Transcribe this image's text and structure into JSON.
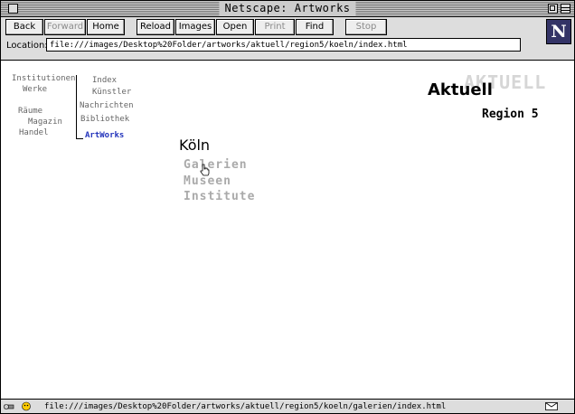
{
  "window": {
    "title": "Netscape: Artworks"
  },
  "toolbar": {
    "buttons": [
      {
        "label": "Back",
        "enabled": true
      },
      {
        "label": "Forward",
        "enabled": false
      },
      {
        "label": "Home",
        "enabled": true
      },
      {
        "label": "Reload",
        "enabled": true
      },
      {
        "label": "Images",
        "enabled": true
      },
      {
        "label": "Open",
        "enabled": true
      },
      {
        "label": "Print",
        "enabled": false
      },
      {
        "label": "Find",
        "enabled": true
      },
      {
        "label": "Stop",
        "enabled": false
      }
    ],
    "location_label": "Location:",
    "location_value": "file:///images/Desktop%20Folder/artworks/aktuell/region5/koeln/index.html",
    "logo": "N"
  },
  "nav": {
    "left": [
      "Institutionen",
      "Werke",
      "Räume",
      "Magazin",
      "Handel"
    ],
    "right": [
      "Index",
      "Künstler",
      "Nachrichten",
      "Bibliothek",
      "ArtWorks"
    ],
    "active": "ArtWorks"
  },
  "header": {
    "shadow_text": "AKTUELL",
    "title": "Aktuell",
    "region": "Region 5"
  },
  "city": {
    "name": "Köln",
    "links": [
      "Galerien",
      "Museen",
      "Institute"
    ]
  },
  "status": {
    "text": "file:///images/Desktop%20Folder/artworks/aktuell/region5/koeln/galerien/index.html"
  }
}
